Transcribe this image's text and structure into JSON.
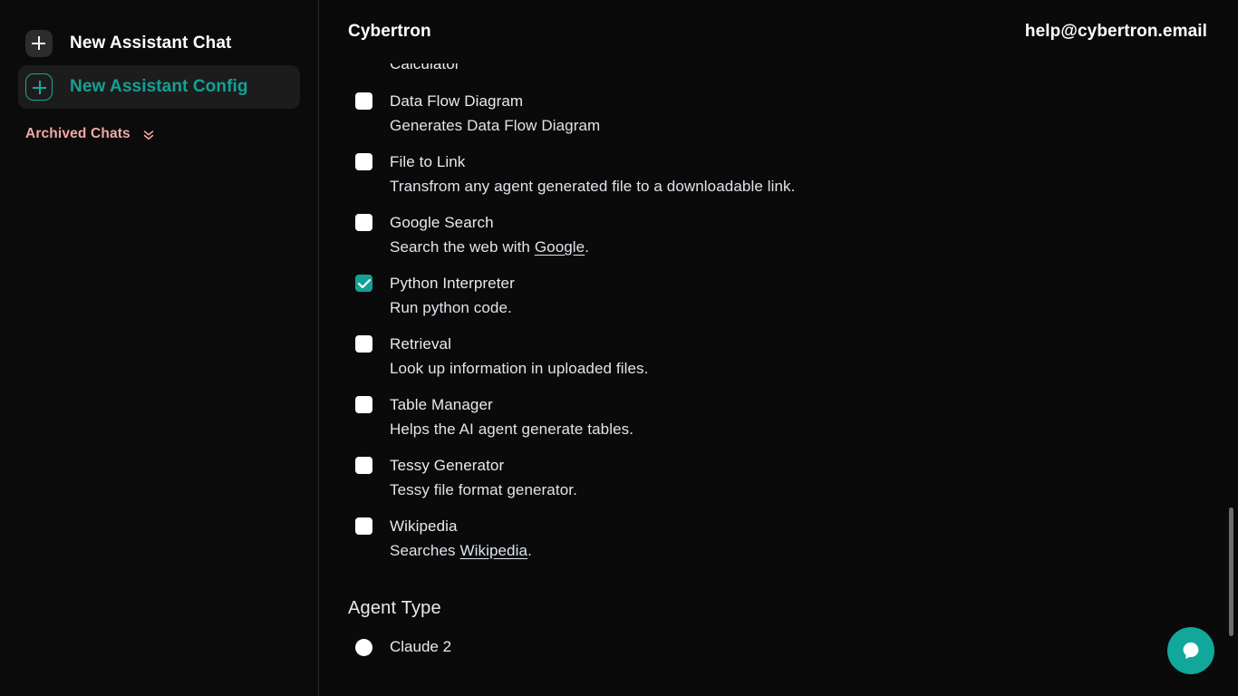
{
  "sidebar": {
    "new_chat": {
      "label": "New Assistant Chat",
      "icon": "plus-icon"
    },
    "new_config": {
      "label": "New Assistant Config",
      "icon": "plus-icon"
    },
    "archived": {
      "label": "Archived Chats",
      "icon": "double-chevron-down-icon"
    }
  },
  "header": {
    "brand": "Cybertron",
    "email": "help@cybertron.email"
  },
  "tools": {
    "items": [
      {
        "name": "Calculator",
        "desc": "",
        "checked": false,
        "clipped": true
      },
      {
        "name": "Data Flow Diagram",
        "desc": "Generates Data Flow Diagram",
        "checked": false
      },
      {
        "name": "File to Link",
        "desc": "Transfrom any agent generated file to a downloadable link.",
        "checked": false
      },
      {
        "name": "Google Search",
        "desc_before": "Search the web with ",
        "desc_link": "Google",
        "desc_after": ".",
        "checked": false
      },
      {
        "name": "Python Interpreter",
        "desc": "Run python code.",
        "checked": true
      },
      {
        "name": "Retrieval",
        "desc": "Look up information in uploaded files.",
        "checked": false
      },
      {
        "name": "Table Manager",
        "desc": "Helps the AI agent generate tables.",
        "checked": false
      },
      {
        "name": "Tessy Generator",
        "desc": "Tessy file format generator.",
        "checked": false
      },
      {
        "name": "Wikipedia",
        "desc_before": "Searches ",
        "desc_link": "Wikipedia",
        "desc_after": ".",
        "checked": false
      }
    ]
  },
  "agent_type": {
    "title": "Agent Type",
    "options": [
      {
        "label": "Claude 2",
        "selected": false
      }
    ]
  },
  "chat_widget": {
    "icon": "chat-bubble-icon"
  },
  "colors": {
    "accent_teal": "#14a195",
    "archived_pink": "#efa8a8",
    "background": "#0a0a0a",
    "text_primary": "#e7ebef"
  }
}
